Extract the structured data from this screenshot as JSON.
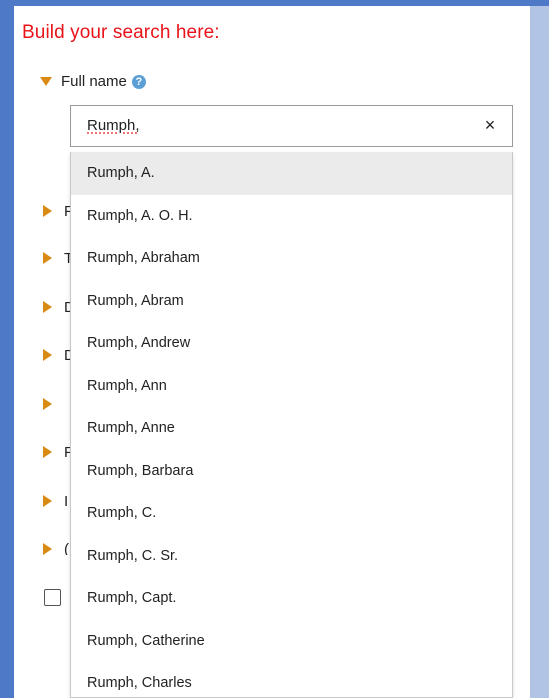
{
  "heading": "Build your search here:",
  "full_name_section": {
    "label": "Full name",
    "help_icon": "?"
  },
  "search": {
    "value": "Rumph,",
    "clear_label": "×"
  },
  "collapsed_sections": [
    "F",
    "T",
    "D",
    "D",
    "",
    "F",
    "I",
    "("
  ],
  "suggestions": [
    "Rumph, A.",
    "Rumph, A. O. H.",
    "Rumph, Abraham",
    "Rumph, Abram",
    "Rumph, Andrew",
    "Rumph, Ann",
    "Rumph, Anne",
    "Rumph, Barbara",
    "Rumph, C.",
    "Rumph, C. Sr.",
    "Rumph, Capt.",
    "Rumph, Catherine",
    "Rumph, Charles"
  ],
  "colors": {
    "heading": "#e8141a",
    "toggle": "#d98a12",
    "border_blue": "#4d79c6",
    "highlight": "#ebebeb"
  }
}
